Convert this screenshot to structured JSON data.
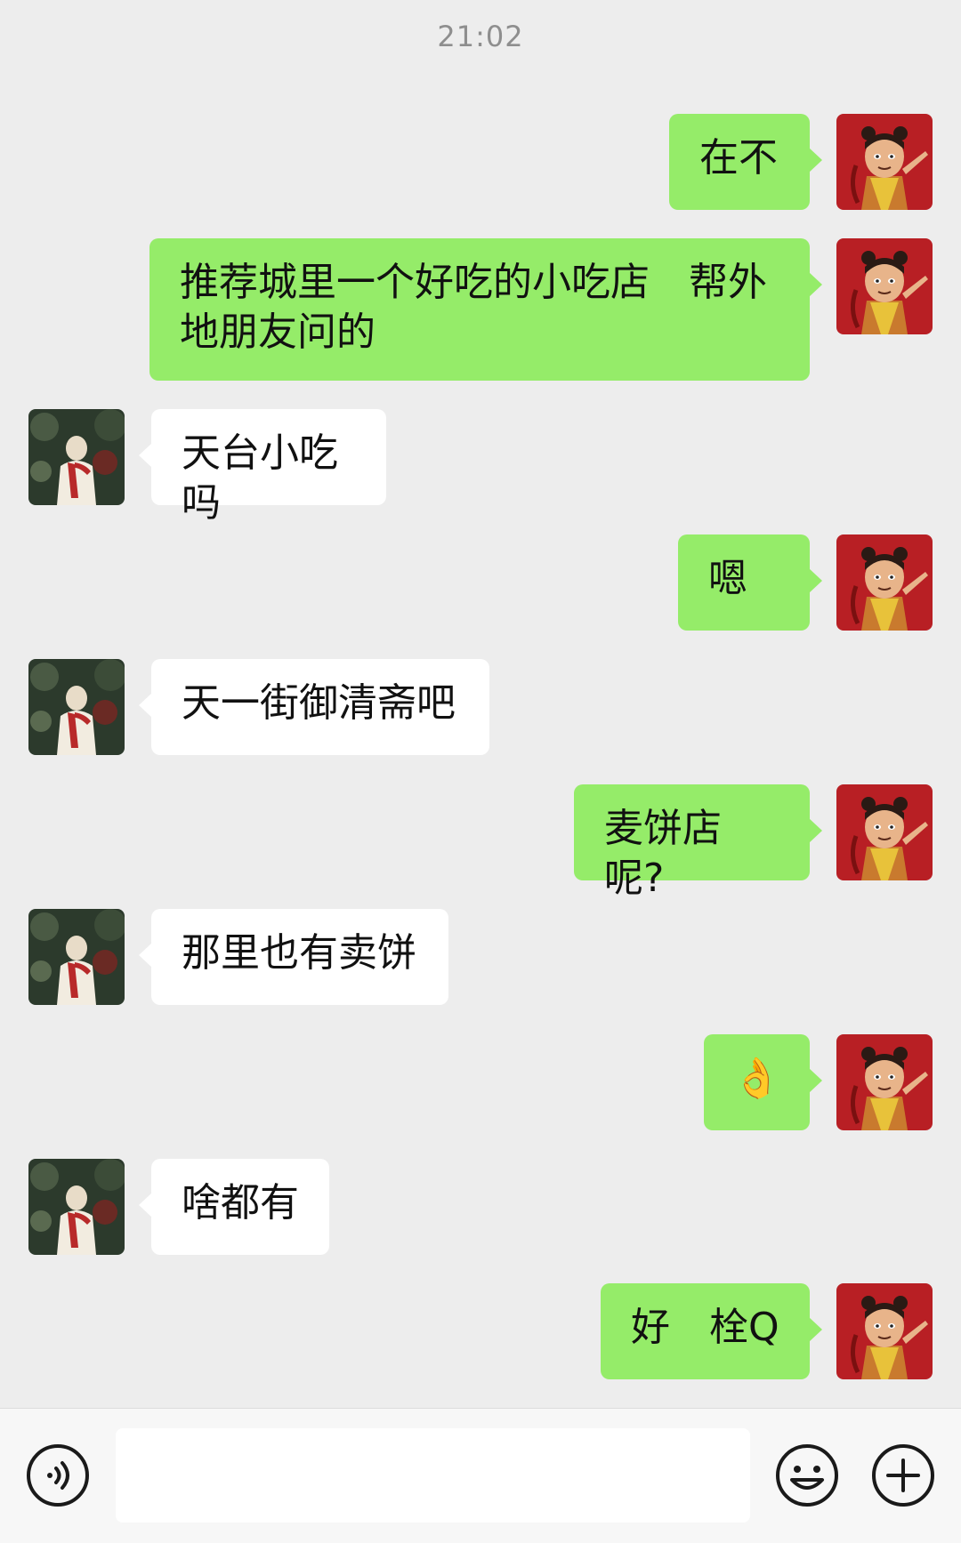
{
  "chat": {
    "timestamp": "21:02",
    "messages": [
      {
        "from": "me",
        "text": "在不"
      },
      {
        "from": "me",
        "text": "推荐城里一个好吃的小吃店　帮外地朋友问的"
      },
      {
        "from": "other",
        "text": "天台小吃吗"
      },
      {
        "from": "me",
        "text": "嗯"
      },
      {
        "from": "other",
        "text": "天一街御清斋吧"
      },
      {
        "from": "me",
        "text": "麦饼店呢?"
      },
      {
        "from": "other",
        "text": "那里也有卖饼"
      },
      {
        "from": "me",
        "text": "👌"
      },
      {
        "from": "other",
        "text": "啥都有"
      },
      {
        "from": "me",
        "text": "好　栓Q"
      }
    ]
  },
  "input_bar": {
    "message_value": "",
    "voice_icon": "voice-icon",
    "emoji_icon": "emoji-icon",
    "plus_icon": "plus-icon"
  },
  "colors": {
    "background": "#ededed",
    "my_bubble": "#95ec69",
    "other_bubble": "#ffffff",
    "my_avatar_bg": "#b81f24",
    "timestamp_text": "#8e8e8e"
  }
}
